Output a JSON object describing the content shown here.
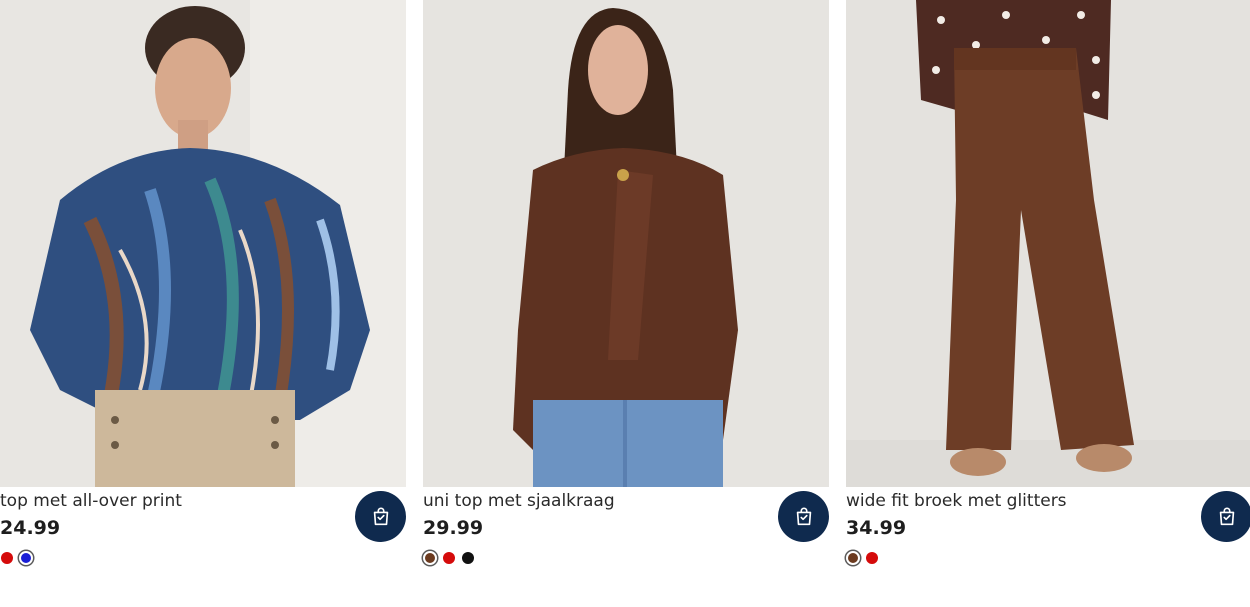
{
  "products": [
    {
      "name": "top met all-over print",
      "price": "24.99",
      "image_alt": "woman wearing blue patterned blouse with beige trousers",
      "swatches": [
        "#d50b0b",
        "#1a1ed6"
      ],
      "cart_icon": "shopping-bag-icon"
    },
    {
      "name": "uni top met sjaalkraag",
      "price": "29.99",
      "image_alt": "woman wearing brown blouse with scarf collar and blue jeans",
      "swatches": [
        "#6b3a1f",
        "#d50b0b",
        "#111111"
      ],
      "cart_icon": "shopping-bag-icon"
    },
    {
      "name": "wide fit broek met glitters",
      "price": "34.99",
      "image_alt": "brown wide leg trousers with polka dot blouse",
      "swatches": [
        "#6b3a1f",
        "#d50b0b"
      ],
      "cart_icon": "shopping-bag-icon"
    }
  ],
  "colors": {
    "cart_button": "#0f2a4e",
    "text": "#2a2a2a"
  }
}
